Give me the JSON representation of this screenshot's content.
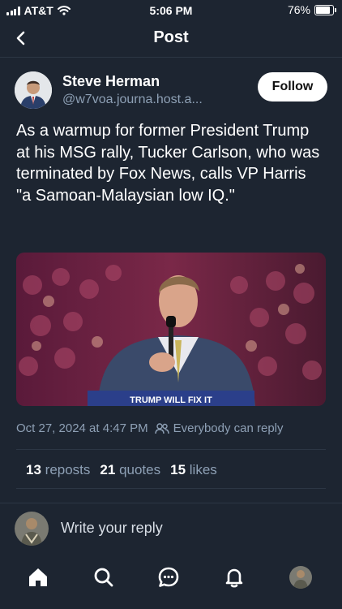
{
  "status_bar": {
    "carrier": "AT&T",
    "time": "5:06 PM",
    "battery": "76%",
    "battery_level": 0.76
  },
  "header": {
    "title": "Post"
  },
  "post": {
    "author_name": "Steve Herman",
    "author_handle": "@w7voa.journa.host.a...",
    "follow_label": "Follow",
    "text": "As a warmup for former President Trump at his MSG rally, Tucker Carlson, who was terminated by Fox News, calls VP Harris \"a Samoan-Malaysian low IQ.\"",
    "media_sign_text": "TRUMP WILL FIX IT",
    "timestamp": "Oct 27, 2024 at 4:47 PM",
    "reply_setting": "Everybody can reply",
    "stats": {
      "reposts_count": "13",
      "reposts_label": "reposts",
      "quotes_count": "21",
      "quotes_label": "quotes",
      "likes_count": "15",
      "likes_label": "likes"
    }
  },
  "reply": {
    "placeholder": "Write your reply"
  },
  "tabbar": {
    "icons": [
      "home-icon",
      "search-icon",
      "chat-icon",
      "bell-icon",
      "profile-avatar"
    ]
  },
  "colors": {
    "background": "#1d2531",
    "muted": "#8ea0b5",
    "divider": "#2c3644",
    "accent": "#ffffff"
  }
}
